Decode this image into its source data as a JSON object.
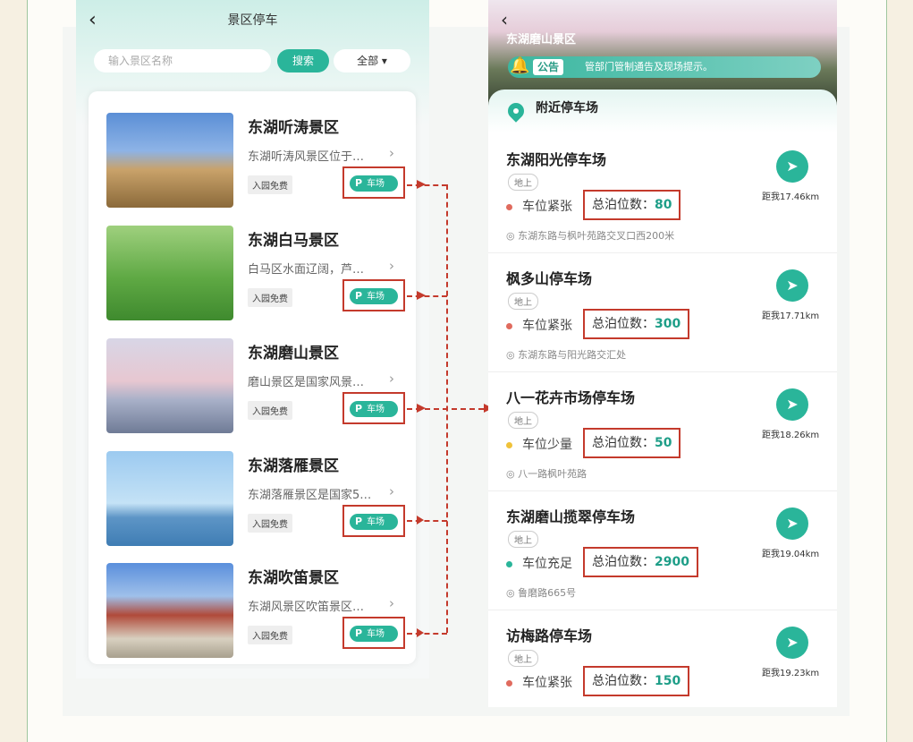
{
  "left": {
    "title": "景区停车",
    "back_icon": "‹",
    "search_placeholder": "输入景区名称",
    "search_label": "搜索",
    "filter_label": "全部",
    "scenic_items": [
      {
        "name": "东湖听涛景区",
        "desc": "东湖听涛风景区位于…",
        "free": "入园免费",
        "parking": "车场"
      },
      {
        "name": "东湖白马景区",
        "desc": "白马区水面辽阔，芦…",
        "free": "入园免费",
        "parking": "车场"
      },
      {
        "name": "东湖磨山景区",
        "desc": "磨山景区是国家风景…",
        "free": "入园免费",
        "parking": "车场"
      },
      {
        "name": "东湖落雁景区",
        "desc": "东湖落雁景区是国家5…",
        "free": "入园免费",
        "parking": "车场"
      },
      {
        "name": "东湖吹笛景区",
        "desc": "东湖风景区吹笛景区…",
        "free": "入园免费",
        "parking": "车场"
      }
    ]
  },
  "right": {
    "title": "东湖磨山景区",
    "notice_tag": "公告",
    "notice_text": "管部门管制通告及现场提示。",
    "section_title": "附近停车场",
    "lots": [
      {
        "name": "东湖阳光停车场",
        "tag": "地上",
        "status": "车位紧张",
        "status_color": "#e06b5e",
        "cap_label": "总泊位数：",
        "cap": "80",
        "addr": "东湖东路与枫叶苑路交叉口西200米",
        "dist": "距我17.46km"
      },
      {
        "name": "枫多山停车场",
        "tag": "地上",
        "status": "车位紧张",
        "status_color": "#e06b5e",
        "cap_label": "总泊位数：",
        "cap": "300",
        "addr": "东湖东路与阳光路交汇处",
        "dist": "距我17.71km"
      },
      {
        "name": "八一花卉市场停车场",
        "tag": "地上",
        "status": "车位少量",
        "status_color": "#f0c23a",
        "cap_label": "总泊位数：",
        "cap": "50",
        "addr": "八一路枫叶苑路",
        "dist": "距我18.26km"
      },
      {
        "name": "东湖磨山揽翠停车场",
        "tag": "地上",
        "status": "车位充足",
        "status_color": "#2ab59a",
        "cap_label": "总泊位数：",
        "cap": "2900",
        "addr": "鲁磨路665号",
        "dist": "距我19.04km"
      },
      {
        "name": "访梅路停车场",
        "tag": "地上",
        "status": "车位紧张",
        "status_color": "#e06b5e",
        "cap_label": "总泊位数：",
        "cap": "150",
        "addr": "",
        "dist": "距我19.23km"
      }
    ]
  },
  "colors": {
    "accent": "#2ab59a",
    "highlight": "#c43a2c"
  }
}
